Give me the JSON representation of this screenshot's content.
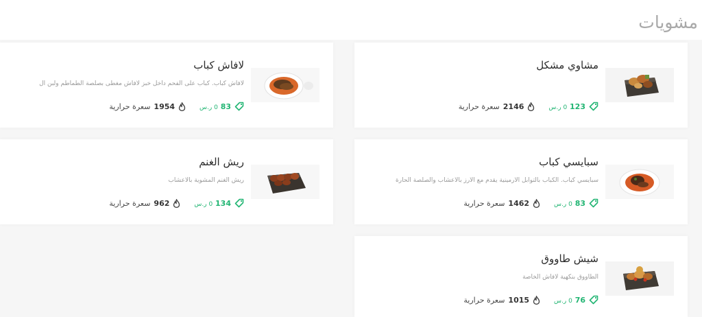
{
  "section": {
    "title": "مشويات"
  },
  "items": [
    {
      "name": "مشاوي مشكل",
      "description": "",
      "price": "123",
      "price_suffix": "0 ر.س",
      "calories": "2146",
      "calories_label": "سعرة حرارية",
      "image": "grill-box-image"
    },
    {
      "name": "لافاش كباب",
      "description": "لافاش كباب. كباب على الفحم داخل خبز لافاش مغطى بصلصة الطماطم ولبن ال",
      "price": "83",
      "price_suffix": "0 ر.س",
      "calories": "1954",
      "calories_label": "سعرة حرارية",
      "image": "plate-kebab-image"
    },
    {
      "name": "سبايسي كباب",
      "description": "سبايسي كباب. الكباب بالتوابل الأرمينية يقدم مع الارز بالأعشاب والصلصة الحارة",
      "price": "83",
      "price_suffix": "0 ر.س",
      "calories": "1462",
      "calories_label": "سعرة حرارية",
      "image": "plate-spicy-image"
    },
    {
      "name": "ريش الغنم",
      "description": "ريش الغنم المشوية بالاعشاب",
      "price": "134",
      "price_suffix": "0 ر.س",
      "calories": "962",
      "calories_label": "سعرة حرارية",
      "image": "ribs-box-image"
    },
    {
      "name": "شيش طاووق",
      "description": "الطاووق بنكهية لافاش الخاصة",
      "price": "76",
      "price_suffix": "0 ر.س",
      "calories": "1015",
      "calories_label": "سعرة حرارية",
      "image": "tawook-box-image"
    }
  ]
}
